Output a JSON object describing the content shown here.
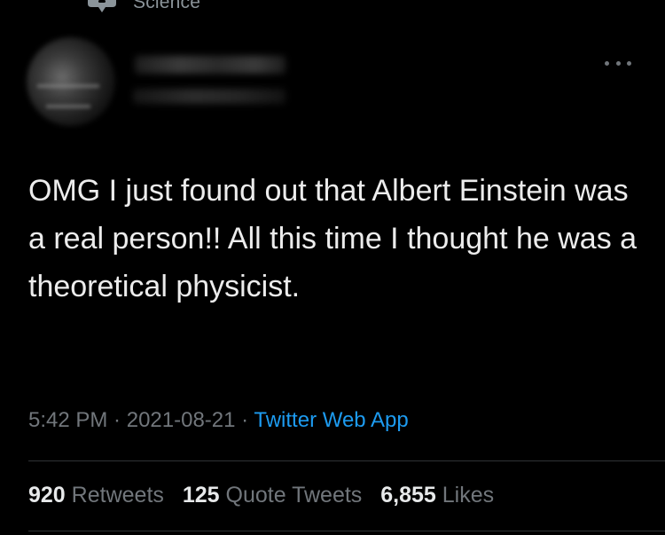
{
  "topic": {
    "label": "Science",
    "icon": "topic-icon"
  },
  "author": {
    "avatar": "avatar",
    "name_blurred": true,
    "handle_blurred": true
  },
  "more_icon": "more-horizontal-icon",
  "tweet": {
    "text": "OMG I just found out that Albert Einstein was a real person!! All this time I thought he was a theoretical physicist.",
    "time": "5:42 PM",
    "separator": " · ",
    "date": "2021-08-21",
    "source": "Twitter Web App"
  },
  "stats": {
    "retweets_count": "920",
    "retweets_label": "Retweets",
    "quotes_count": "125",
    "quotes_label": "Quote Tweets",
    "likes_count": "6,855",
    "likes_label": "Likes"
  },
  "colors": {
    "background": "#000000",
    "text": "#e7e9ea",
    "secondary": "#71767b",
    "link": "#1d9bf0",
    "divider": "#2f3336"
  }
}
